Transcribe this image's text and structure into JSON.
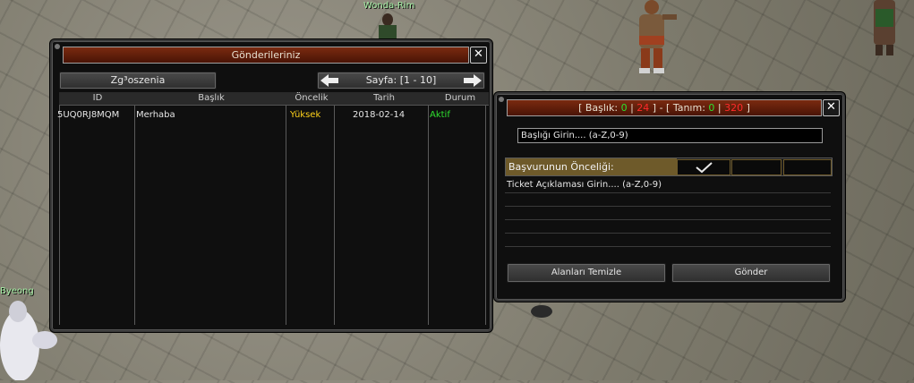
{
  "scene": {
    "npc_top_name": "Wonda-Rim",
    "player_name": "Byeong"
  },
  "submissions_window": {
    "title": "Gönderileriniz",
    "tab_label": "Zg³oszenia",
    "pagination": {
      "label": "Sayfa: [1 - 10]"
    },
    "columns": [
      "ID",
      "Başlık",
      "Öncelik",
      "Tarih",
      "Durum"
    ],
    "rows": [
      {
        "id": "5UQ0RJ8MQM",
        "title": "Merhaba",
        "priority": "Yüksek",
        "date": "2018-02-14",
        "status": "Aktif"
      }
    ],
    "colors": {
      "priority": "#ffd21a",
      "status": "#2fe02f"
    }
  },
  "ticket_window": {
    "header": {
      "prefix": "[ Başlık:",
      "title_count": "0",
      "sep1": "|",
      "title_max": "24",
      "mid": "] - [ Tanım:",
      "desc_count": "0",
      "sep2": "|",
      "desc_max": "320",
      "suffix": "]"
    },
    "title_placeholder": "Başlığı Girin.... (a-Z,0-9)",
    "priority_label": "Başvurunun Önceliği:",
    "description_placeholder": "Ticket Açıklaması Girin.... (a-Z,0-9)",
    "clear_button": "Alanları Temizle",
    "send_button": "Gönder",
    "colors": {
      "count": "#2fe02f",
      "max": "#ff2a2a"
    }
  }
}
